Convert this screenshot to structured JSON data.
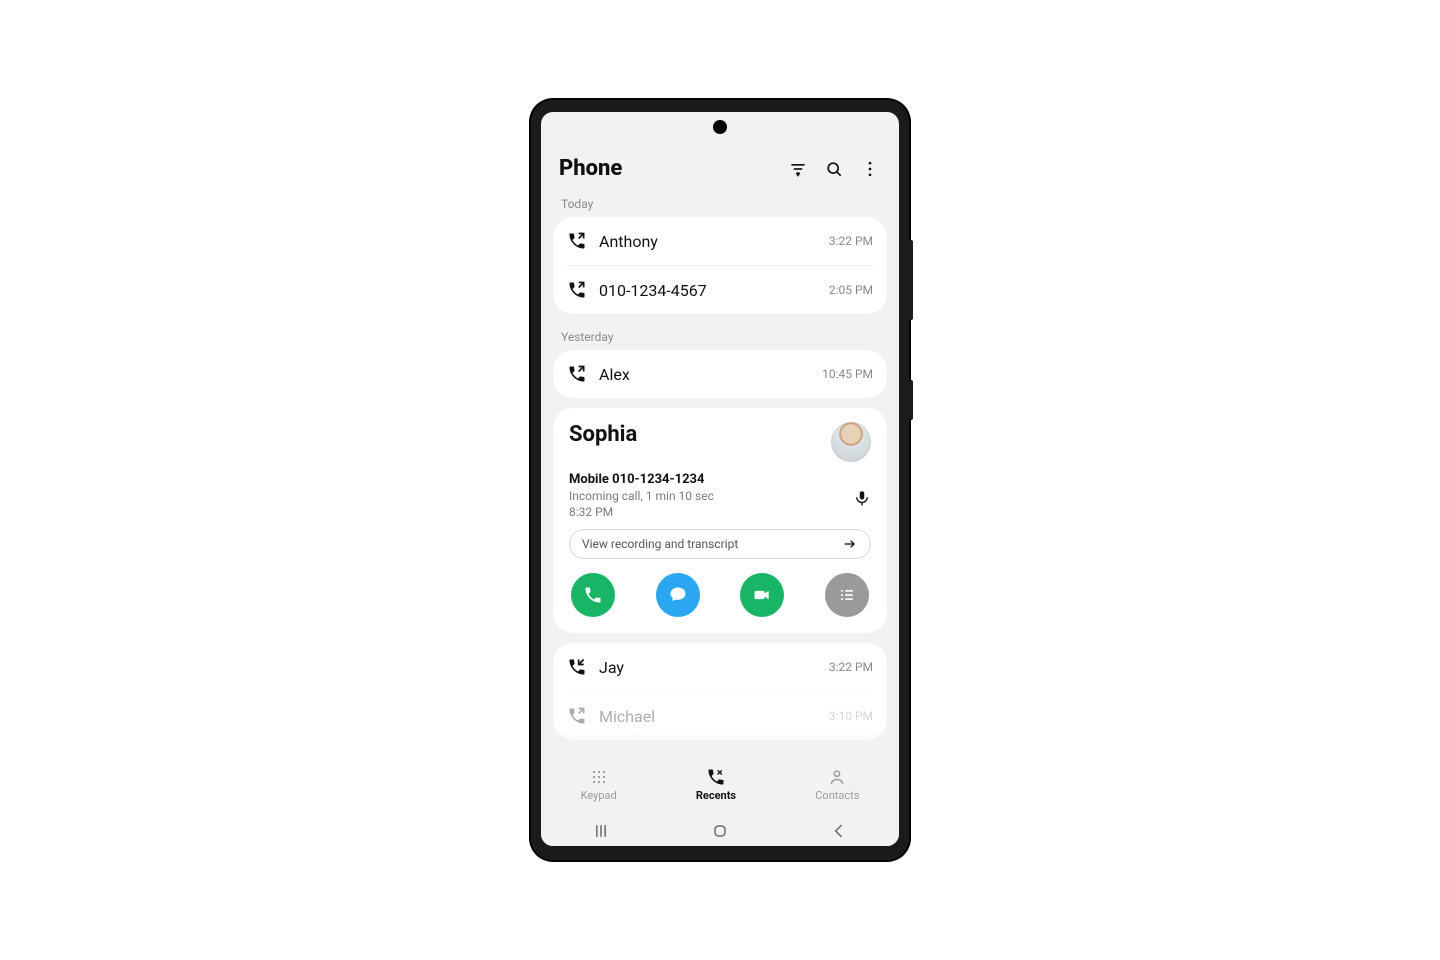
{
  "header": {
    "title": "Phone"
  },
  "sections": [
    {
      "label": "Today",
      "calls": [
        {
          "name": "Anthony",
          "time": "3:22 PM",
          "direction": "outgoing"
        },
        {
          "name": "010-1234-4567",
          "time": "2:05 PM",
          "direction": "outgoing"
        }
      ]
    },
    {
      "label": "Yesterday",
      "calls": [
        {
          "name": "Alex",
          "time": "10:45 PM",
          "direction": "outgoing"
        }
      ]
    }
  ],
  "expanded": {
    "name": "Sophia",
    "number_label": "Mobile 010-1234-1234",
    "call_detail": "Incoming call, 1 min 10 sec",
    "time": "8:32 PM",
    "pill": "View recording and transcript"
  },
  "more_calls": [
    {
      "name": "Jay",
      "time": "3:22 PM",
      "direction": "incoming"
    },
    {
      "name": "Michael",
      "time": "3:10 PM",
      "direction": "outgoing"
    }
  ],
  "tabs": {
    "keypad": "Keypad",
    "recents": "Recents",
    "contacts": "Contacts"
  }
}
